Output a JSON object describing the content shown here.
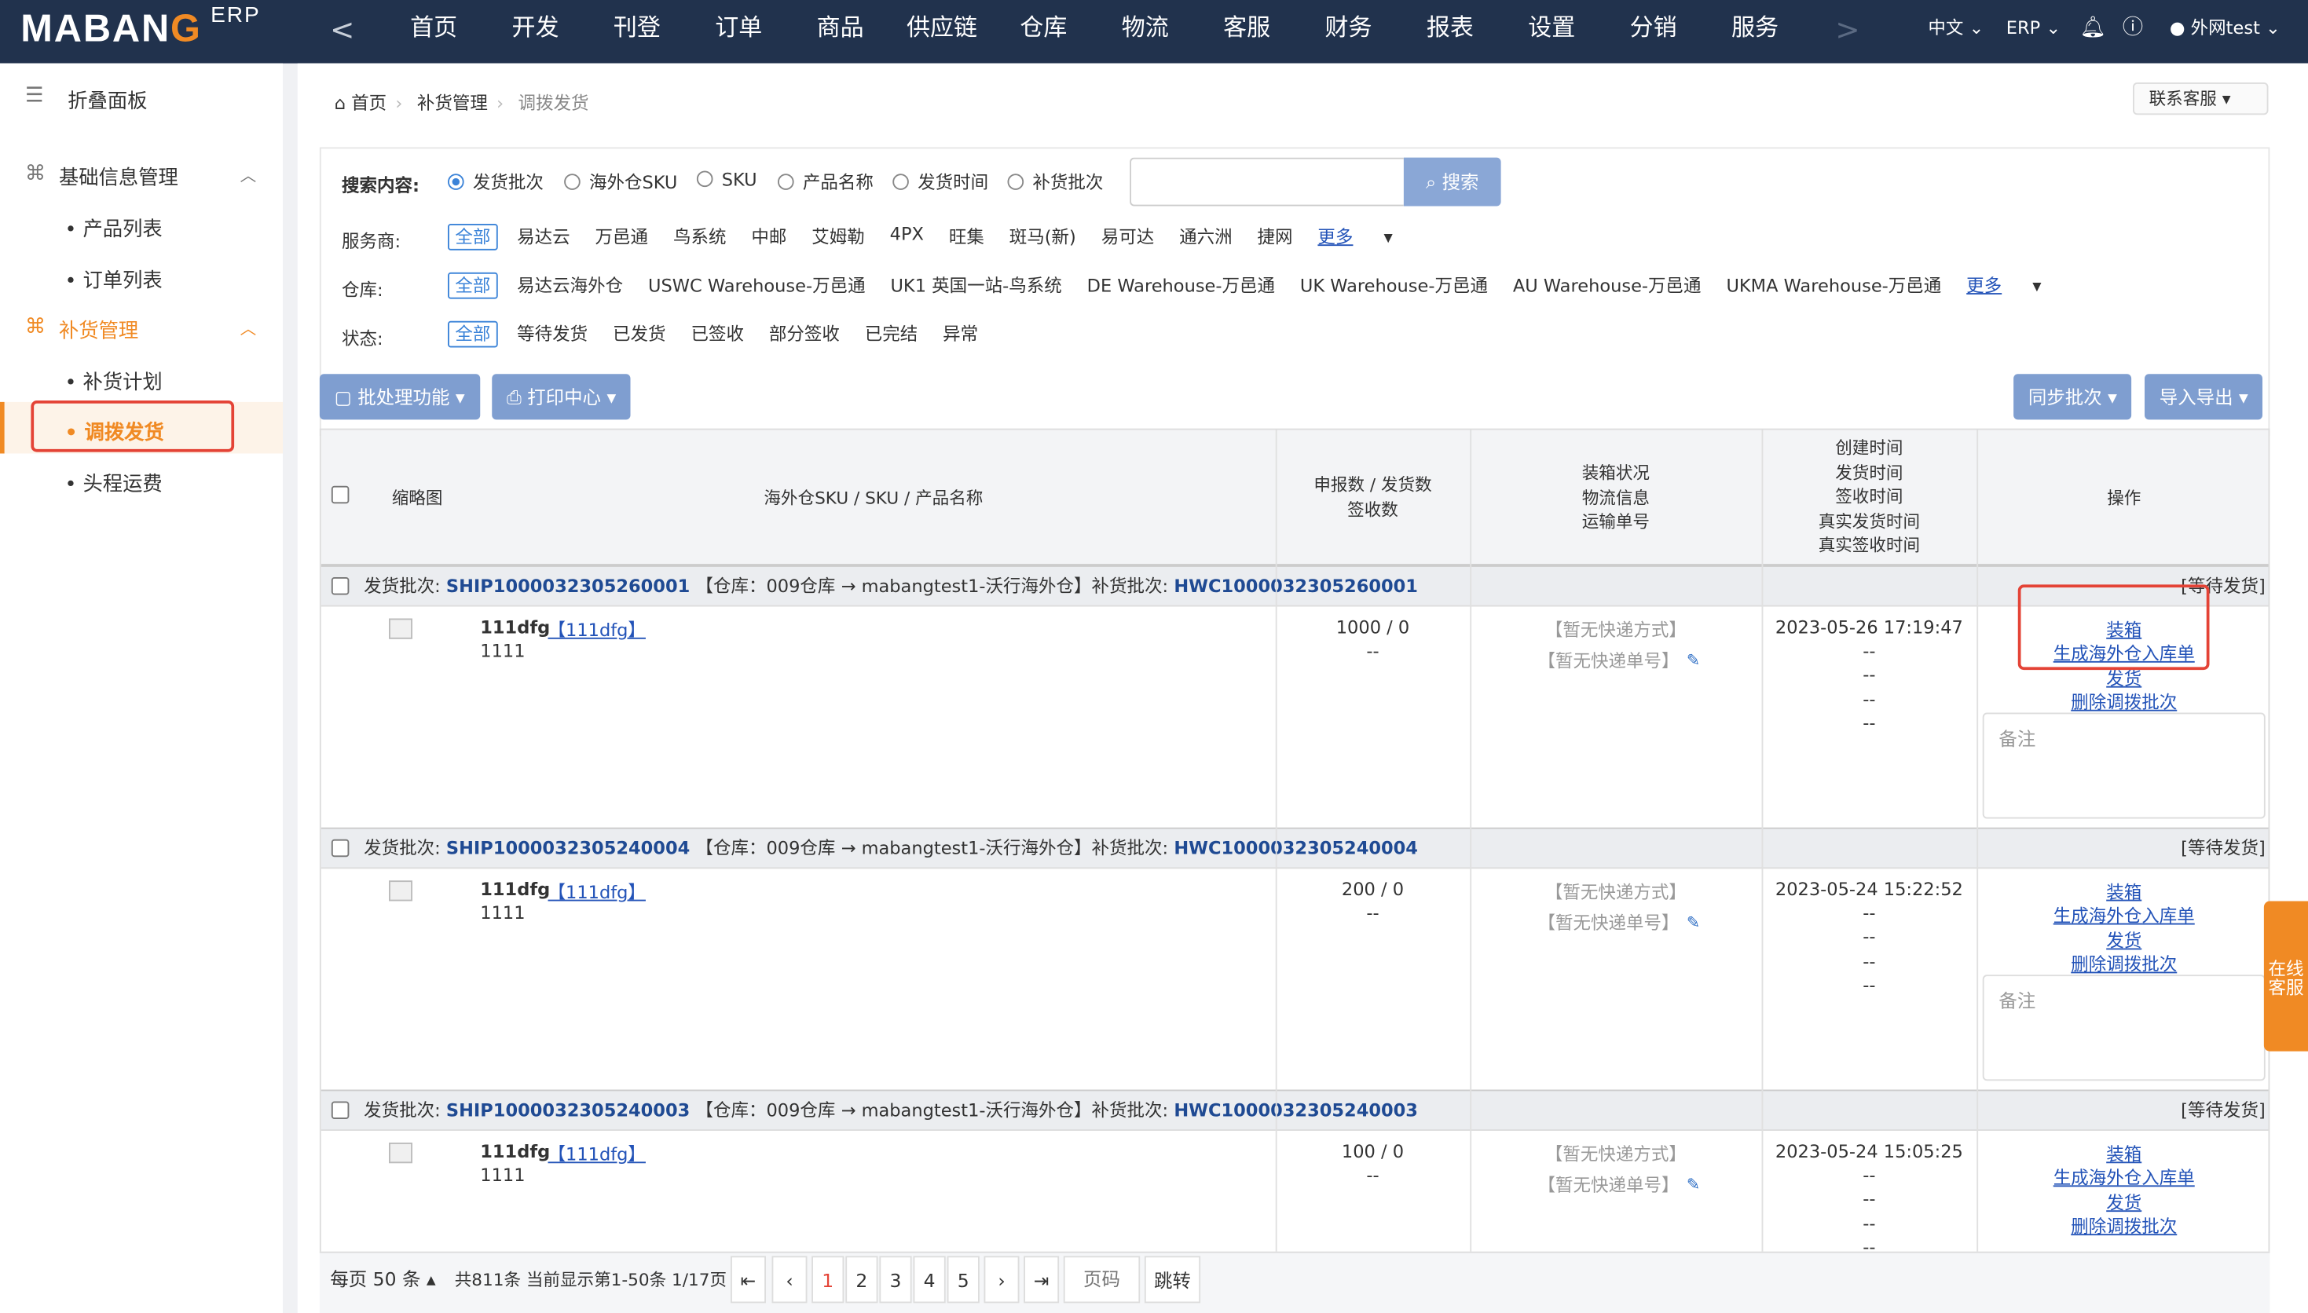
{
  "header": {
    "logo_text_a": "MABAN",
    "logo_text_b": "G",
    "logo_suffix": "ERP",
    "back": "<",
    "nav": [
      "首页",
      "开发",
      "刊登",
      "订单",
      "商品",
      "供应链",
      "仓库",
      "物流",
      "客服",
      "财务",
      "报表",
      "设置",
      "分销",
      "服务"
    ],
    "forward": ">",
    "lang": "中文",
    "erp": "ERP",
    "user": "外网test"
  },
  "sidebar": {
    "collapse": "折叠面板",
    "group1": "基础信息管理",
    "g1items": [
      "产品列表",
      "订单列表"
    ],
    "group2": "补货管理",
    "g2items": [
      "补货计划",
      "调拨发货",
      "头程运费"
    ],
    "active": "调拨发货"
  },
  "breadcrumb": {
    "home": "首页",
    "parent": "补货管理",
    "current": "调拨发货"
  },
  "kefu": "联系客服",
  "search": {
    "label": "搜索内容:",
    "options": [
      "发货批次",
      "海外仓SKU",
      "SKU",
      "产品名称",
      "发货时间",
      "补货批次"
    ],
    "selected": "发货批次",
    "value": "",
    "button": "搜索"
  },
  "filters": {
    "carrier_label": "服务商:",
    "carriers": [
      "全部",
      "易达云",
      "万邑通",
      "鸟系统",
      "中邮",
      "艾姆勒",
      "4PX",
      "旺集",
      "斑马(新)",
      "易可达",
      "通六洲",
      "捷网",
      "更多"
    ],
    "warehouse_label": "仓库:",
    "warehouses": [
      "全部",
      "易达云海外仓",
      "USWC Warehouse-万邑通",
      "UK1 英国一站-鸟系统",
      "DE Warehouse-万邑通",
      "UK Warehouse-万邑通",
      "AU Warehouse-万邑通",
      "UKMA Warehouse-万邑通",
      "更多"
    ],
    "status_label": "状态:",
    "statuses": [
      "全部",
      "等待发货",
      "已发货",
      "已签收",
      "部分签收",
      "已完结",
      "异常"
    ]
  },
  "toolbar": {
    "batch": "批处理功能",
    "print": "打印中心",
    "sync": "同步批次",
    "io": "导入导出"
  },
  "table": {
    "headers": {
      "thumb": "缩略图",
      "sku": "海外仓SKU / SKU / 产品名称",
      "qty1": "申报数 / 发货数",
      "qty2": "签收数",
      "pack": [
        "装箱状况",
        "物流信息",
        "运输单号"
      ],
      "times": [
        "创建时间",
        "发货时间",
        "签收时间",
        "真实发货时间",
        "真实签收时间"
      ],
      "ops": "操作"
    },
    "groups": [
      {
        "batch_label": "发货批次:",
        "batch": "SHIP1000032305260001",
        "route": "【仓库：009仓库 → mabangtest1-沃行海外仓】",
        "rep_label": "补货批次:",
        "rep": "HWC1000032305260001",
        "status": "[等待发货]",
        "sku": "111dfg",
        "sku_link": "【111dfg】",
        "sub": "1111",
        "qty": "1000 / 0",
        "qty2": "--",
        "express": "【暂无快递方式】",
        "tracking": "【暂无快递单号】",
        "created": "2023-05-26 17:19:47",
        "dashes": [
          "--",
          "--",
          "--",
          "--"
        ]
      },
      {
        "batch_label": "发货批次:",
        "batch": "SHIP1000032305240004",
        "route": "【仓库：009仓库 → mabangtest1-沃行海外仓】",
        "rep_label": "补货批次:",
        "rep": "HWC1000032305240004",
        "status": "[等待发货]",
        "sku": "111dfg",
        "sku_link": "【111dfg】",
        "sub": "1111",
        "qty": "200 / 0",
        "qty2": "--",
        "express": "【暂无快递方式】",
        "tracking": "【暂无快递单号】",
        "created": "2023-05-24 15:22:52",
        "dashes": [
          "--",
          "--",
          "--",
          "--"
        ]
      },
      {
        "batch_label": "发货批次:",
        "batch": "SHIP1000032305240003",
        "route": "【仓库：009仓库 → mabangtest1-沃行海外仓】",
        "rep_label": "补货批次:",
        "rep": "HWC1000032305240003",
        "status": "[等待发货]",
        "sku": "111dfg",
        "sku_link": "【111dfg】",
        "sub": "1111",
        "qty": "100 / 0",
        "qty2": "--",
        "express": "【暂无快递方式】",
        "tracking": "【暂无快递单号】",
        "created": "2023-05-24 15:05:25",
        "dashes": [
          "--",
          "--",
          "--",
          "--"
        ]
      }
    ],
    "ops": [
      "装箱",
      "生成海外仓入库单",
      "发货",
      "删除调拨批次"
    ],
    "note_placeholder": "备注"
  },
  "pager": {
    "per_page": "每页 50 条",
    "summary": "共811条 当前显示第1-50条 1/17页",
    "pages": [
      "1",
      "2",
      "3",
      "4",
      "5"
    ],
    "current": "1",
    "goto_placeholder": "页码",
    "jump": "跳转"
  },
  "float_service": "在线客服"
}
